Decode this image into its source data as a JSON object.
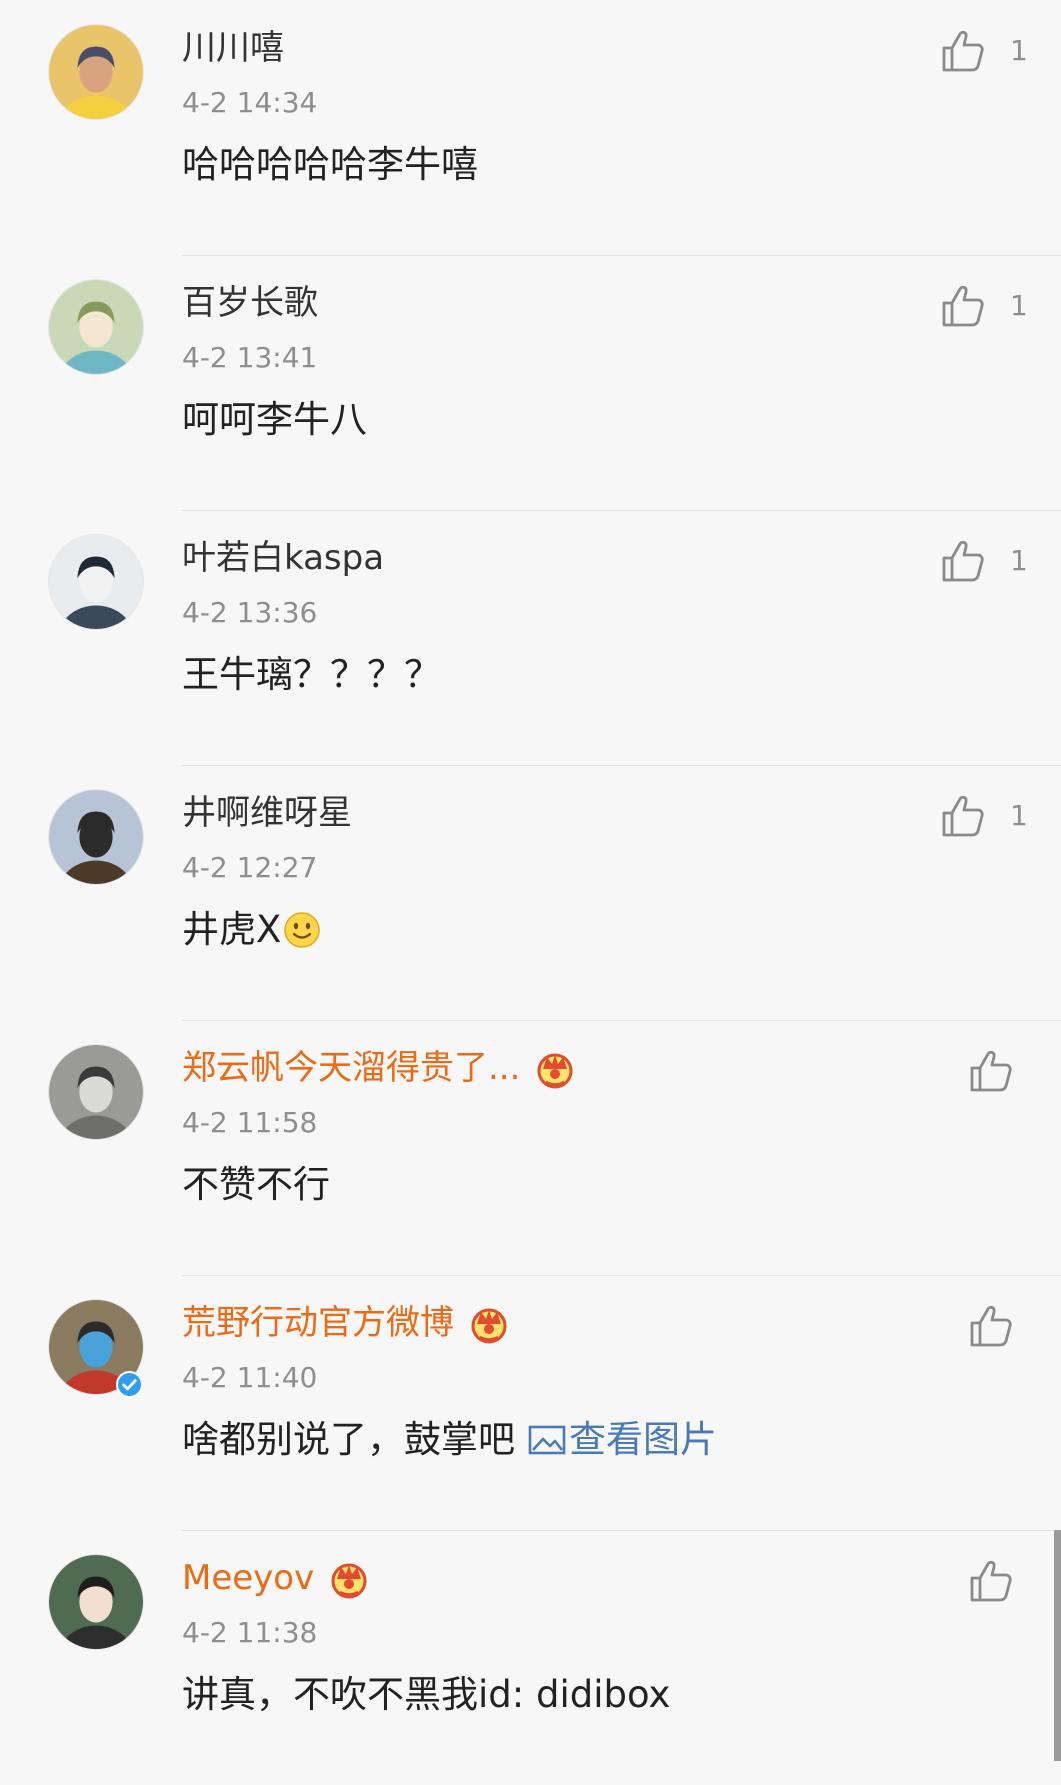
{
  "comments": [
    {
      "username": "川川嘻",
      "time": "4-2 14:34",
      "content": "哈哈哈哈哈李牛嘻",
      "like_count": "1",
      "vip": false,
      "avatar": {
        "bg": "#e9c46a",
        "face": "#d8a47f",
        "hair": "#4a4e69",
        "shirt": "#f4d03f"
      }
    },
    {
      "username": "百岁长歌",
      "time": "4-2 13:41",
      "content": "呵呵李牛八",
      "like_count": "1",
      "vip": false,
      "avatar": {
        "bg": "#c9d8b6",
        "face": "#f5e6d3",
        "hair": "#8a9a5b",
        "shirt": "#6fb7c4"
      }
    },
    {
      "username": "叶若白kaspa",
      "time": "4-2 13:36",
      "content": "王牛璃？？？？",
      "like_count": "1",
      "vip": false,
      "avatar": {
        "bg": "#e8ecef",
        "face": "#f2f2f2",
        "hair": "#1f2a36",
        "shirt": "#3b4a5a"
      }
    },
    {
      "username": "井啊维呀星",
      "time": "4-2 12:27",
      "content": "井虎X",
      "emoji": "smile",
      "like_count": "1",
      "vip": false,
      "avatar": {
        "bg": "#b7c4d6",
        "face": "#2b2b2b",
        "hair": "#2b2b2b",
        "shirt": "#4d3b2a"
      }
    },
    {
      "username": "郑云帆今天溜得贵了...",
      "time": "4-2 11:58",
      "content": "不赞不行",
      "like_count": "",
      "vip": true,
      "avatar": {
        "bg": "#9a9a96",
        "face": "#d9d9d5",
        "hair": "#3a3a3a",
        "shirt": "#6e6e6a"
      }
    },
    {
      "username": "荒野行动官方微博",
      "time": "4-2 11:40",
      "content": "啥都别说了，鼓掌吧",
      "link_text": "查看图片",
      "like_count": "",
      "vip": true,
      "verified": true,
      "avatar": {
        "bg": "#8a7a60",
        "face": "#4aa0d8",
        "hair": "#2a2a2a",
        "shirt": "#c0392b"
      }
    },
    {
      "username": "Meeyov",
      "time": "4-2 11:38",
      "content": "讲真，不吹不黑我id: didibox",
      "like_count": "",
      "vip": true,
      "avatar": {
        "bg": "#4f6b52",
        "face": "#f2dfd0",
        "hair": "#1e1e1e",
        "shirt": "#2e2e2e"
      }
    }
  ],
  "colors": {
    "background": "#f7f7f7",
    "vip_name": "#ec6a13",
    "link": "#4a7ab3",
    "meta": "#8e8e8e"
  },
  "icons": [
    "thumbs-up-icon",
    "crown-icon",
    "verified-icon",
    "image-icon",
    "smile-emoji-icon"
  ]
}
